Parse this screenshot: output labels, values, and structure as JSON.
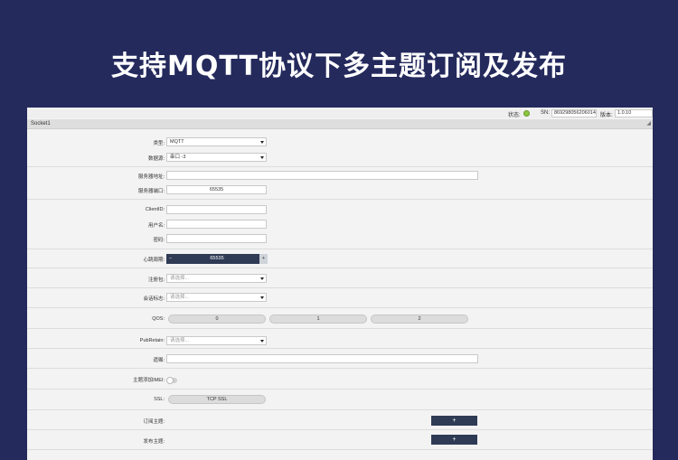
{
  "banner": {
    "title": "支持MQTT协议下多主题订阅及发布"
  },
  "status": {
    "state_label": "状态:",
    "sn_label": "SN:",
    "sn_value": "869298056206014",
    "version_label": "版本:",
    "version_value": "1.0.10",
    "state_color": "#8cc63f"
  },
  "socket": {
    "tab_label": "Socket1"
  },
  "form": {
    "type": {
      "label": "类型:",
      "value": "MQTT"
    },
    "data_source": {
      "label": "数据源:",
      "value": "串口 -3"
    },
    "server_address": {
      "label": "服务器地址:",
      "value": ""
    },
    "server_port": {
      "label": "服务器端口:",
      "value": "65535"
    },
    "client_id": {
      "label": "ClientID:",
      "value": ""
    },
    "username": {
      "label": "用户名:",
      "value": ""
    },
    "password": {
      "label": "密码:",
      "value": ""
    },
    "heartbeat": {
      "label": "心跳周期:",
      "value": "65535",
      "minus": "−",
      "plus": "+"
    },
    "register_packet": {
      "label": "注册包:",
      "placeholder": "请选择..."
    },
    "session_flag": {
      "label": "会话标志:",
      "placeholder": "请选择..."
    },
    "qos": {
      "label": "QOS:",
      "options": [
        "0",
        "1",
        "2"
      ]
    },
    "pub_retain": {
      "label": "PubRetain:",
      "placeholder": "请选择..."
    },
    "will": {
      "label": "遗嘱:",
      "value": ""
    },
    "topic_imei": {
      "label": "主题添加IMEI:"
    },
    "ssl": {
      "label": "SSL:",
      "value": "TCP SSL"
    },
    "subscribe_topic": {
      "label": "订阅主题:",
      "add": "+"
    },
    "publish_topic": {
      "label": "发布主题:",
      "add": "+"
    }
  },
  "colors": {
    "banner_bg": "#242a5c",
    "accent_dark": "#2f3b55"
  }
}
